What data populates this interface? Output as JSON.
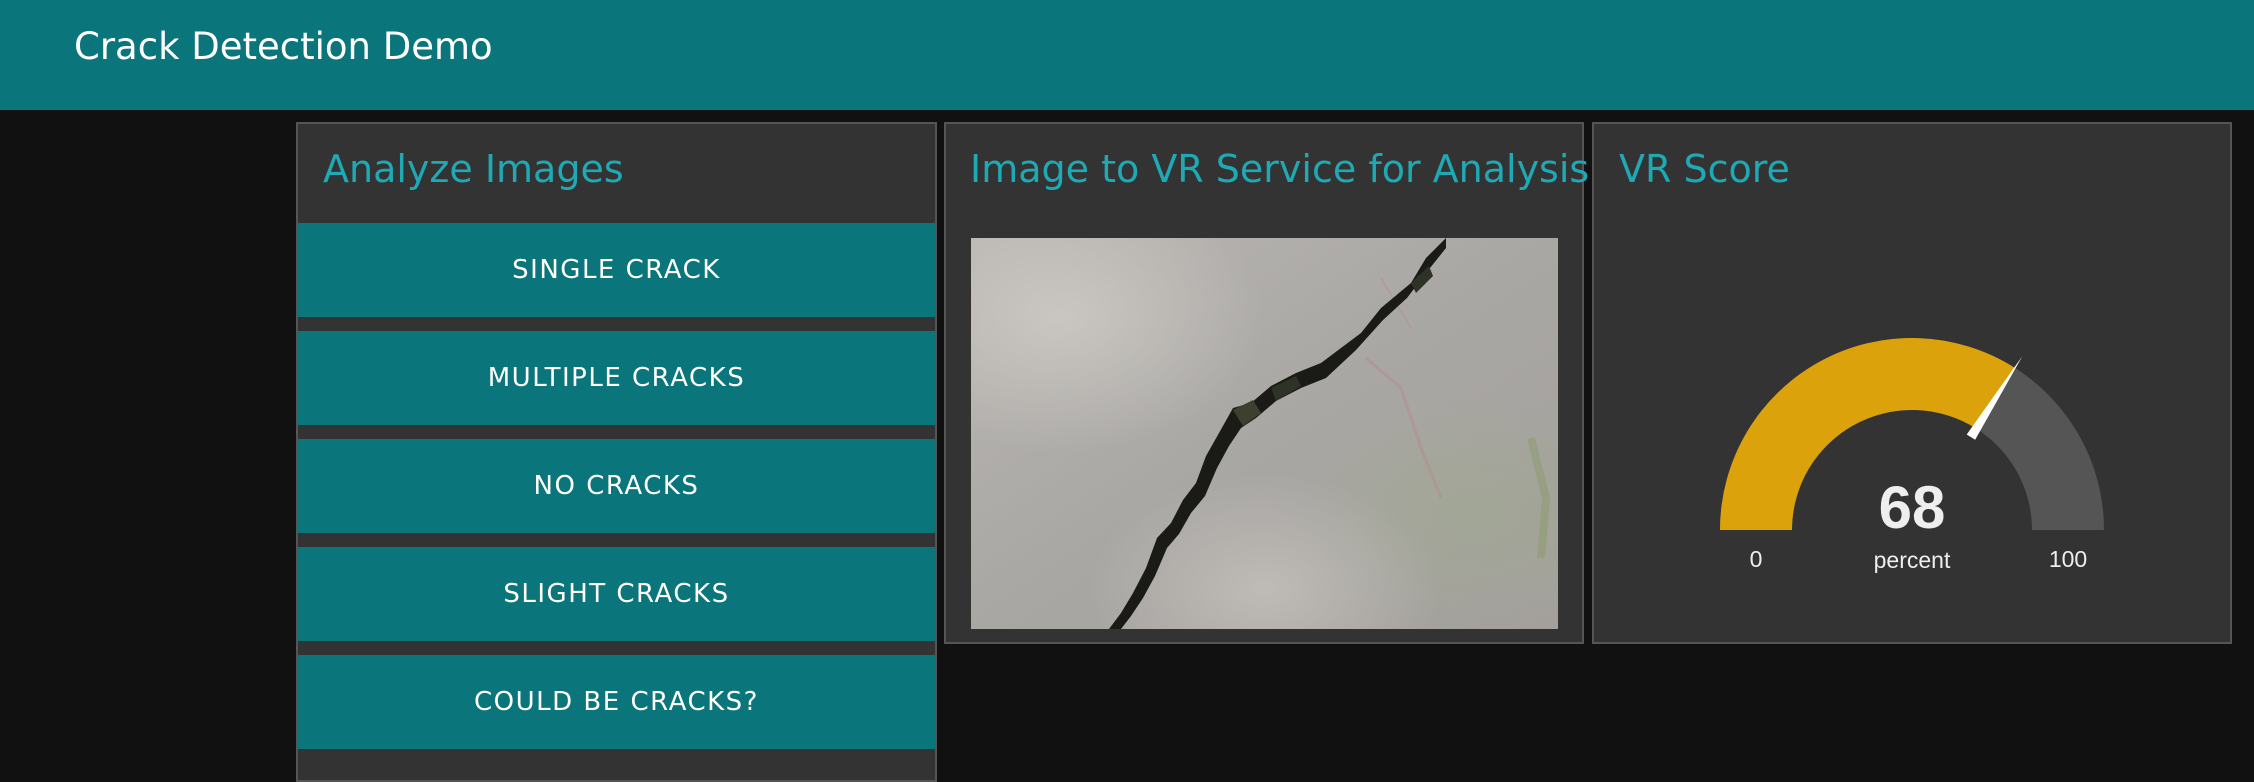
{
  "header": {
    "title": "Crack Detection Demo"
  },
  "analyze_panel": {
    "title": "Analyze Images",
    "buttons": [
      "SINGLE CRACK",
      "MULTIPLE CRACKS",
      "NO CRACKS",
      "SLIGHT CRACKS",
      "COULD BE CRACKS?"
    ]
  },
  "image_panel": {
    "title": "Image to VR Service for Analysis"
  },
  "score_panel": {
    "title": "VR Score",
    "gauge": {
      "value": 68,
      "min": 0,
      "max": 100,
      "min_label": "0",
      "max_label": "100",
      "unit": "percent",
      "value_label": "68"
    }
  },
  "colors": {
    "header": "#0b757c",
    "button": "#0b757c",
    "title_accent": "#1ea9b5",
    "gauge_fill": "#dba20c",
    "gauge_track": "#555555",
    "background": "#111111",
    "panel": "#333333"
  }
}
